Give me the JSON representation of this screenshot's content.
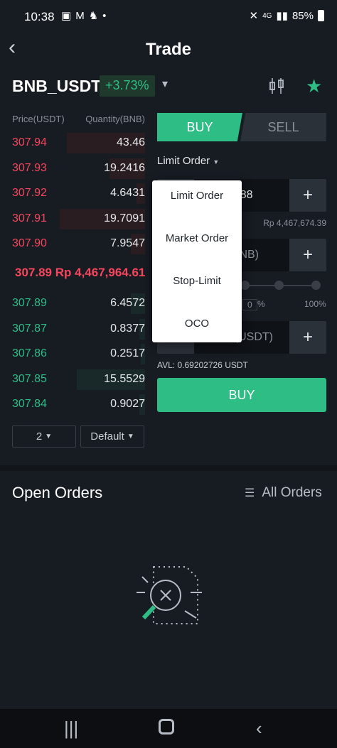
{
  "status_bar": {
    "time": "10:38",
    "notification_icons": [
      "image-icon",
      "gmail-icon",
      "app-icon",
      "dot-icon"
    ],
    "signal_text": "4G",
    "battery": "85%"
  },
  "header": {
    "title": "Trade"
  },
  "pair": {
    "symbol": "BNB_USDT",
    "change": "+3.73%"
  },
  "order_book": {
    "price_header": "Price(USDT)",
    "qty_header": "Quantity(BNB)",
    "asks": [
      {
        "price": "307.94",
        "qty": "43.46",
        "depth": 0.55
      },
      {
        "price": "307.93",
        "qty": "19.2416",
        "depth": 0.25
      },
      {
        "price": "307.92",
        "qty": "4.6431",
        "depth": 0.06
      },
      {
        "price": "307.91",
        "qty": "19.7091",
        "depth": 0.6
      },
      {
        "price": "307.90",
        "qty": "7.9547",
        "depth": 0.1
      }
    ],
    "mid_price": "307.89",
    "mid_fiat": "Rp 4,467,964.61",
    "bids": [
      {
        "price": "307.89",
        "qty": "6.4572",
        "depth": 0.1
      },
      {
        "price": "307.87",
        "qty": "0.8377",
        "depth": 0.04
      },
      {
        "price": "307.86",
        "qty": "0.2517",
        "depth": 0.03
      },
      {
        "price": "307.85",
        "qty": "15.5529",
        "depth": 0.48
      },
      {
        "price": "307.84",
        "qty": "0.9027",
        "depth": 0.04
      }
    ],
    "precision_select": "2",
    "view_select": "Default"
  },
  "order_form": {
    "buy_tab": "BUY",
    "sell_tab": "SELL",
    "order_type": "Limit Order",
    "price_value": "7.88",
    "price_fiat": "Rp 4,467,674.39",
    "amount_placeholder": "t(BNB)",
    "slider_pct_value": "0",
    "slider_pct_symbol": "%",
    "slider_max": "100%",
    "total_placeholder": "Total(USDT)",
    "minus": "−",
    "plus": "+",
    "avl": "AVL: 0.69202726 USDT",
    "buy_button": "BUY"
  },
  "order_type_dropdown": {
    "options": [
      "Limit Order",
      "Market Order",
      "Stop-Limit",
      "OCO"
    ]
  },
  "open_orders": {
    "title": "Open Orders",
    "all_orders": "All Orders"
  },
  "colors": {
    "buy": "#2ebd85",
    "sell": "#f6465d",
    "background": "#171b22"
  }
}
